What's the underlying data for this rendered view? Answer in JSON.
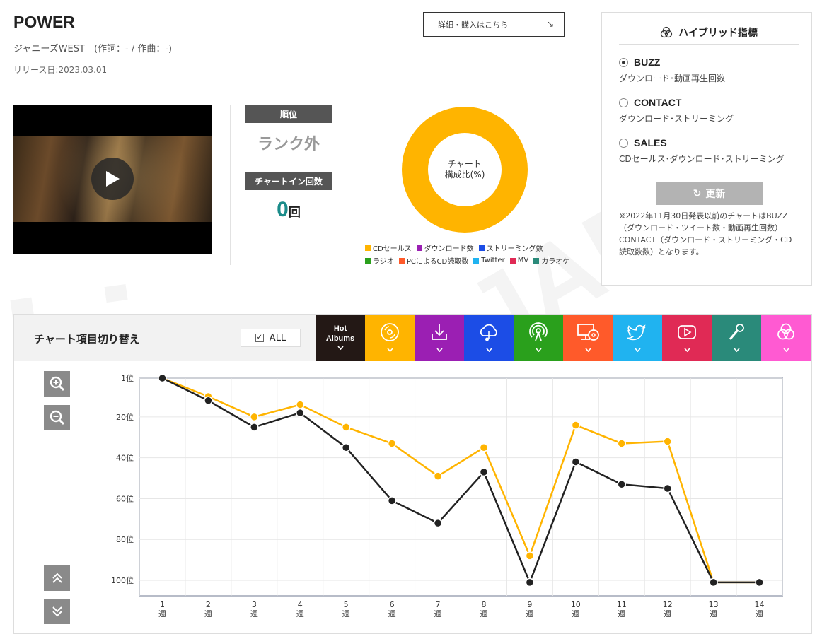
{
  "song": {
    "title": "POWER",
    "artist_line": "ジャニーズWEST　(作詞：- / 作曲：-)",
    "release": "リリース日:2023.03.01",
    "detail_button": "詳細・購入はこちら",
    "detail_arrow": "↘"
  },
  "video": {
    "play_icon": "play-icon"
  },
  "rank": {
    "rank_label": "順位",
    "rank_value": "ランク外",
    "chartin_label": "チャートイン回数",
    "chartin_value": "0",
    "chartin_unit": "回"
  },
  "composition": {
    "center_line1": "チャート",
    "center_line2": "構成比(%)",
    "donut_color": "#ffb400",
    "legend": [
      {
        "label": "CDセールス",
        "color": "#ffb400"
      },
      {
        "label": "ダウンロード数",
        "color": "#9b1fb3"
      },
      {
        "label": "ストリーミング数",
        "color": "#1c4de6"
      },
      {
        "label": "ラジオ",
        "color": "#2aa01c"
      },
      {
        "label": "PCによるCD読取数",
        "color": "#ff5a2a"
      },
      {
        "label": "Twitter",
        "color": "#20b3f0"
      },
      {
        "label": "MV",
        "color": "#e02a55"
      },
      {
        "label": "カラオケ",
        "color": "#2a8a7a"
      }
    ]
  },
  "hybrid": {
    "title": "ハイブリッド指標",
    "options": [
      {
        "name": "BUZZ",
        "desc": "ダウンロード･動画再生回数",
        "selected": true
      },
      {
        "name": "CONTACT",
        "desc": "ダウンロード･ストリーミング",
        "selected": false
      },
      {
        "name": "SALES",
        "desc": "CDセールス･ダウンロード･ストリーミング",
        "selected": false
      }
    ],
    "update_button": "更新",
    "note": "※2022年11月30日発表以前のチャートはBUZZ（ダウンロード・ツイート数・動画再生回数）CONTACT（ダウンロード・ストリーミング・CD読取数数）となります。"
  },
  "chart_panel": {
    "title": "チャート項目切り替え",
    "all_label": "ALL",
    "tabs": [
      {
        "label": "Hot\nAlbums",
        "icon": "hot-albums",
        "color": "#231815"
      },
      {
        "label": "",
        "icon": "cd-icon",
        "color": "#ffb400"
      },
      {
        "label": "",
        "icon": "download-icon",
        "color": "#9b1fb3"
      },
      {
        "label": "",
        "icon": "cloud-music-icon",
        "color": "#1c4de6"
      },
      {
        "label": "",
        "icon": "radio-icon",
        "color": "#2aa01c"
      },
      {
        "label": "",
        "icon": "pc-cd-icon",
        "color": "#ff5a2a"
      },
      {
        "label": "",
        "icon": "twitter-icon",
        "color": "#20b3f0"
      },
      {
        "label": "",
        "icon": "video-icon",
        "color": "#e02a55"
      },
      {
        "label": "",
        "icon": "microphone-icon",
        "color": "#2a8a7a"
      },
      {
        "label": "",
        "icon": "hybrid-icon",
        "color": "#ff5ad2"
      }
    ],
    "controls": [
      "zoom-in-icon",
      "zoom-out-icon",
      "scroll-up-icon",
      "scroll-down-icon"
    ]
  },
  "chart_data": {
    "type": "line",
    "x": [
      "1\n週",
      "2\n週",
      "3\n週",
      "4\n週",
      "5\n週",
      "6\n週",
      "7\n週",
      "8\n週",
      "9\n週",
      "10\n週",
      "11\n週",
      "12\n週",
      "13\n週",
      "14\n週"
    ],
    "y_ticks": [
      "1位",
      "20位",
      "40位",
      "60位",
      "80位",
      "100位"
    ],
    "y_tick_values": [
      1,
      20,
      40,
      60,
      80,
      100
    ],
    "ylim": [
      1,
      100
    ],
    "y_inverted": true,
    "grid": true,
    "series": [
      {
        "color": "#ffb400",
        "values": [
          1,
          10,
          20,
          14,
          25,
          33,
          49,
          35,
          88,
          24,
          33,
          32,
          101,
          101
        ]
      },
      {
        "color": "#222222",
        "values": [
          1,
          12,
          25,
          18,
          35,
          61,
          72,
          47,
          101,
          42,
          53,
          55,
          101,
          101
        ]
      }
    ]
  }
}
